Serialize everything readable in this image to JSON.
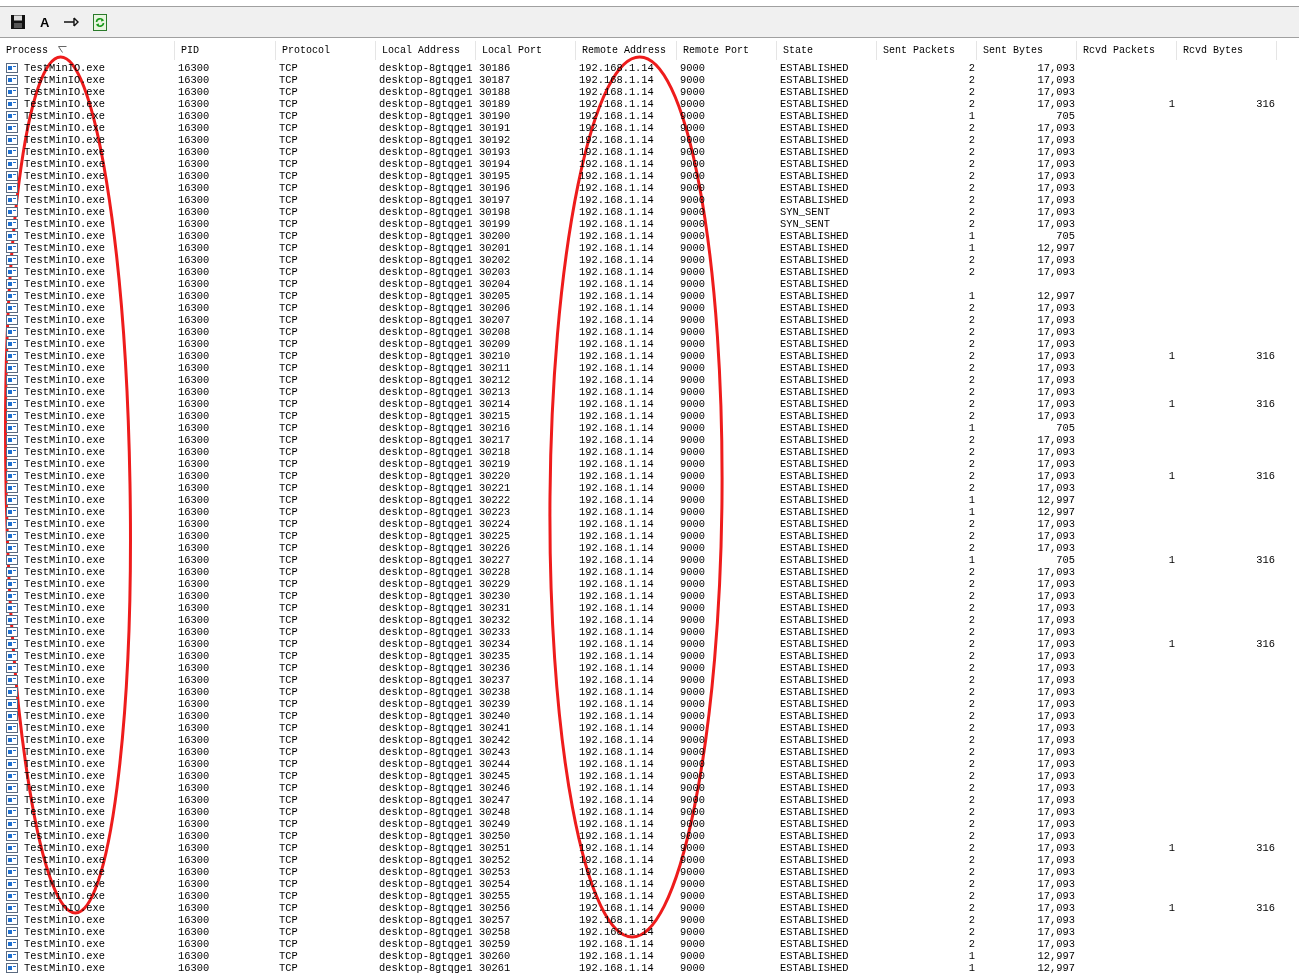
{
  "toolbar": [
    {
      "kind": "save"
    },
    {
      "kind": "text",
      "label": "A"
    },
    {
      "kind": "pin"
    },
    {
      "kind": "refresh"
    }
  ],
  "table": {
    "columns": [
      {
        "label": "Process",
        "sorted": true
      },
      {
        "label": "PID",
        "sorted": false
      },
      {
        "label": "Protocol",
        "sorted": false
      },
      {
        "label": "Local Address",
        "sorted": false
      },
      {
        "label": "Local Port",
        "sorted": false
      },
      {
        "label": "Remote Address",
        "sorted": false
      },
      {
        "label": "Remote Port",
        "sorted": false
      },
      {
        "label": "State",
        "sorted": false
      },
      {
        "label": "Sent Packets",
        "sorted": false
      },
      {
        "label": "Sent Bytes",
        "sorted": false
      },
      {
        "label": "Rcvd Packets",
        "sorted": false
      },
      {
        "label": "Rcvd Bytes",
        "sorted": false
      }
    ],
    "rows": [
      {
        "process": "TestMinIO.exe",
        "pid": "16300",
        "protocol": "TCP",
        "local_address": "desktop-8gtqge1",
        "local_port": "30186",
        "remote_address": "192.168.1.14",
        "remote_port": "9000",
        "state": "ESTABLISHED",
        "sent_packets": "2",
        "sent_bytes": "17,093"
      },
      {
        "process": "TestMinIO.exe",
        "pid": "16300",
        "protocol": "TCP",
        "local_address": "desktop-8gtqge1",
        "local_port": "30187",
        "remote_address": "192.168.1.14",
        "remote_port": "9000",
        "state": "ESTABLISHED",
        "sent_packets": "2",
        "sent_bytes": "17,093"
      },
      {
        "process": "TestMinIO.exe",
        "pid": "16300",
        "protocol": "TCP",
        "local_address": "desktop-8gtqge1",
        "local_port": "30188",
        "remote_address": "192.168.1.14",
        "remote_port": "9000",
        "state": "ESTABLISHED",
        "sent_packets": "2",
        "sent_bytes": "17,093"
      },
      {
        "process": "TestMinIO.exe",
        "pid": "16300",
        "protocol": "TCP",
        "local_address": "desktop-8gtqge1",
        "local_port": "30189",
        "remote_address": "192.168.1.14",
        "remote_port": "9000",
        "state": "ESTABLISHED",
        "sent_packets": "2",
        "sent_bytes": "17,093",
        "rcvd_packets": "1",
        "rcvd_bytes": "316"
      },
      {
        "process": "TestMinIO.exe",
        "pid": "16300",
        "protocol": "TCP",
        "local_address": "desktop-8gtqge1",
        "local_port": "30190",
        "remote_address": "192.168.1.14",
        "remote_port": "9000",
        "state": "ESTABLISHED",
        "sent_packets": "1",
        "sent_bytes": "705"
      },
      {
        "process": "TestMinIO.exe",
        "pid": "16300",
        "protocol": "TCP",
        "local_address": "desktop-8gtqge1",
        "local_port": "30191",
        "remote_address": "192.168.1.14",
        "remote_port": "9000",
        "state": "ESTABLISHED",
        "sent_packets": "2",
        "sent_bytes": "17,093"
      },
      {
        "process": "TestMinIO.exe",
        "pid": "16300",
        "protocol": "TCP",
        "local_address": "desktop-8gtqge1",
        "local_port": "30192",
        "remote_address": "192.168.1.14",
        "remote_port": "9000",
        "state": "ESTABLISHED",
        "sent_packets": "2",
        "sent_bytes": "17,093"
      },
      {
        "process": "TestMinIO.exe",
        "pid": "16300",
        "protocol": "TCP",
        "local_address": "desktop-8gtqge1",
        "local_port": "30193",
        "remote_address": "192.168.1.14",
        "remote_port": "9000",
        "state": "ESTABLISHED",
        "sent_packets": "2",
        "sent_bytes": "17,093"
      },
      {
        "process": "TestMinIO.exe",
        "pid": "16300",
        "protocol": "TCP",
        "local_address": "desktop-8gtqge1",
        "local_port": "30194",
        "remote_address": "192.168.1.14",
        "remote_port": "9000",
        "state": "ESTABLISHED",
        "sent_packets": "2",
        "sent_bytes": "17,093"
      },
      {
        "process": "TestMinIO.exe",
        "pid": "16300",
        "protocol": "TCP",
        "local_address": "desktop-8gtqge1",
        "local_port": "30195",
        "remote_address": "192.168.1.14",
        "remote_port": "9000",
        "state": "ESTABLISHED",
        "sent_packets": "2",
        "sent_bytes": "17,093"
      },
      {
        "process": "TestMinIO.exe",
        "pid": "16300",
        "protocol": "TCP",
        "local_address": "desktop-8gtqge1",
        "local_port": "30196",
        "remote_address": "192.168.1.14",
        "remote_port": "9000",
        "state": "ESTABLISHED",
        "sent_packets": "2",
        "sent_bytes": "17,093"
      },
      {
        "process": "TestMinIO.exe",
        "pid": "16300",
        "protocol": "TCP",
        "local_address": "desktop-8gtqge1",
        "local_port": "30197",
        "remote_address": "192.168.1.14",
        "remote_port": "9000",
        "state": "ESTABLISHED",
        "sent_packets": "2",
        "sent_bytes": "17,093"
      },
      {
        "process": "TestMinIO.exe",
        "pid": "16300",
        "protocol": "TCP",
        "local_address": "desktop-8gtqge1",
        "local_port": "30198",
        "remote_address": "192.168.1.14",
        "remote_port": "9000",
        "state": "SYN_SENT",
        "sent_packets": "2",
        "sent_bytes": "17,093"
      },
      {
        "process": "TestMinIO.exe",
        "pid": "16300",
        "protocol": "TCP",
        "local_address": "desktop-8gtqge1",
        "local_port": "30199",
        "remote_address": "192.168.1.14",
        "remote_port": "9000",
        "state": "SYN_SENT",
        "sent_packets": "2",
        "sent_bytes": "17,093"
      },
      {
        "process": "TestMinIO.exe",
        "pid": "16300",
        "protocol": "TCP",
        "local_address": "desktop-8gtqge1",
        "local_port": "30200",
        "remote_address": "192.168.1.14",
        "remote_port": "9000",
        "state": "ESTABLISHED",
        "sent_packets": "1",
        "sent_bytes": "705"
      },
      {
        "process": "TestMinIO.exe",
        "pid": "16300",
        "protocol": "TCP",
        "local_address": "desktop-8gtqge1",
        "local_port": "30201",
        "remote_address": "192.168.1.14",
        "remote_port": "9000",
        "state": "ESTABLISHED",
        "sent_packets": "1",
        "sent_bytes": "12,997"
      },
      {
        "process": "TestMinIO.exe",
        "pid": "16300",
        "protocol": "TCP",
        "local_address": "desktop-8gtqge1",
        "local_port": "30202",
        "remote_address": "192.168.1.14",
        "remote_port": "9000",
        "state": "ESTABLISHED",
        "sent_packets": "2",
        "sent_bytes": "17,093"
      },
      {
        "process": "TestMinIO.exe",
        "pid": "16300",
        "protocol": "TCP",
        "local_address": "desktop-8gtqge1",
        "local_port": "30203",
        "remote_address": "192.168.1.14",
        "remote_port": "9000",
        "state": "ESTABLISHED",
        "sent_packets": "2",
        "sent_bytes": "17,093"
      },
      {
        "process": "TestMinIO.exe",
        "pid": "16300",
        "protocol": "TCP",
        "local_address": "desktop-8gtqge1",
        "local_port": "30204",
        "remote_address": "192.168.1.14",
        "remote_port": "9000",
        "state": "ESTABLISHED"
      },
      {
        "process": "TestMinIO.exe",
        "pid": "16300",
        "protocol": "TCP",
        "local_address": "desktop-8gtqge1",
        "local_port": "30205",
        "remote_address": "192.168.1.14",
        "remote_port": "9000",
        "state": "ESTABLISHED",
        "sent_packets": "1",
        "sent_bytes": "12,997"
      },
      {
        "process": "TestMinIO.exe",
        "pid": "16300",
        "protocol": "TCP",
        "local_address": "desktop-8gtqge1",
        "local_port": "30206",
        "remote_address": "192.168.1.14",
        "remote_port": "9000",
        "state": "ESTABLISHED",
        "sent_packets": "2",
        "sent_bytes": "17,093"
      },
      {
        "process": "TestMinIO.exe",
        "pid": "16300",
        "protocol": "TCP",
        "local_address": "desktop-8gtqge1",
        "local_port": "30207",
        "remote_address": "192.168.1.14",
        "remote_port": "9000",
        "state": "ESTABLISHED",
        "sent_packets": "2",
        "sent_bytes": "17,093"
      },
      {
        "process": "TestMinIO.exe",
        "pid": "16300",
        "protocol": "TCP",
        "local_address": "desktop-8gtqge1",
        "local_port": "30208",
        "remote_address": "192.168.1.14",
        "remote_port": "9000",
        "state": "ESTABLISHED",
        "sent_packets": "2",
        "sent_bytes": "17,093"
      },
      {
        "process": "TestMinIO.exe",
        "pid": "16300",
        "protocol": "TCP",
        "local_address": "desktop-8gtqge1",
        "local_port": "30209",
        "remote_address": "192.168.1.14",
        "remote_port": "9000",
        "state": "ESTABLISHED",
        "sent_packets": "2",
        "sent_bytes": "17,093"
      },
      {
        "process": "TestMinIO.exe",
        "pid": "16300",
        "protocol": "TCP",
        "local_address": "desktop-8gtqge1",
        "local_port": "30210",
        "remote_address": "192.168.1.14",
        "remote_port": "9000",
        "state": "ESTABLISHED",
        "sent_packets": "2",
        "sent_bytes": "17,093",
        "rcvd_packets": "1",
        "rcvd_bytes": "316"
      },
      {
        "process": "TestMinIO.exe",
        "pid": "16300",
        "protocol": "TCP",
        "local_address": "desktop-8gtqge1",
        "local_port": "30211",
        "remote_address": "192.168.1.14",
        "remote_port": "9000",
        "state": "ESTABLISHED",
        "sent_packets": "2",
        "sent_bytes": "17,093"
      },
      {
        "process": "TestMinIO.exe",
        "pid": "16300",
        "protocol": "TCP",
        "local_address": "desktop-8gtqge1",
        "local_port": "30212",
        "remote_address": "192.168.1.14",
        "remote_port": "9000",
        "state": "ESTABLISHED",
        "sent_packets": "2",
        "sent_bytes": "17,093"
      },
      {
        "process": "TestMinIO.exe",
        "pid": "16300",
        "protocol": "TCP",
        "local_address": "desktop-8gtqge1",
        "local_port": "30213",
        "remote_address": "192.168.1.14",
        "remote_port": "9000",
        "state": "ESTABLISHED",
        "sent_packets": "2",
        "sent_bytes": "17,093"
      },
      {
        "process": "TestMinIO.exe",
        "pid": "16300",
        "protocol": "TCP",
        "local_address": "desktop-8gtqge1",
        "local_port": "30214",
        "remote_address": "192.168.1.14",
        "remote_port": "9000",
        "state": "ESTABLISHED",
        "sent_packets": "2",
        "sent_bytes": "17,093",
        "rcvd_packets": "1",
        "rcvd_bytes": "316"
      },
      {
        "process": "TestMinIO.exe",
        "pid": "16300",
        "protocol": "TCP",
        "local_address": "desktop-8gtqge1",
        "local_port": "30215",
        "remote_address": "192.168.1.14",
        "remote_port": "9000",
        "state": "ESTABLISHED",
        "sent_packets": "2",
        "sent_bytes": "17,093"
      },
      {
        "process": "TestMinIO.exe",
        "pid": "16300",
        "protocol": "TCP",
        "local_address": "desktop-8gtqge1",
        "local_port": "30216",
        "remote_address": "192.168.1.14",
        "remote_port": "9000",
        "state": "ESTABLISHED",
        "sent_packets": "1",
        "sent_bytes": "705"
      },
      {
        "process": "TestMinIO.exe",
        "pid": "16300",
        "protocol": "TCP",
        "local_address": "desktop-8gtqge1",
        "local_port": "30217",
        "remote_address": "192.168.1.14",
        "remote_port": "9000",
        "state": "ESTABLISHED",
        "sent_packets": "2",
        "sent_bytes": "17,093"
      },
      {
        "process": "TestMinIO.exe",
        "pid": "16300",
        "protocol": "TCP",
        "local_address": "desktop-8gtqge1",
        "local_port": "30218",
        "remote_address": "192.168.1.14",
        "remote_port": "9000",
        "state": "ESTABLISHED",
        "sent_packets": "2",
        "sent_bytes": "17,093"
      },
      {
        "process": "TestMinIO.exe",
        "pid": "16300",
        "protocol": "TCP",
        "local_address": "desktop-8gtqge1",
        "local_port": "30219",
        "remote_address": "192.168.1.14",
        "remote_port": "9000",
        "state": "ESTABLISHED",
        "sent_packets": "2",
        "sent_bytes": "17,093"
      },
      {
        "process": "TestMinIO.exe",
        "pid": "16300",
        "protocol": "TCP",
        "local_address": "desktop-8gtqge1",
        "local_port": "30220",
        "remote_address": "192.168.1.14",
        "remote_port": "9000",
        "state": "ESTABLISHED",
        "sent_packets": "2",
        "sent_bytes": "17,093",
        "rcvd_packets": "1",
        "rcvd_bytes": "316"
      },
      {
        "process": "TestMinIO.exe",
        "pid": "16300",
        "protocol": "TCP",
        "local_address": "desktop-8gtqge1",
        "local_port": "30221",
        "remote_address": "192.168.1.14",
        "remote_port": "9000",
        "state": "ESTABLISHED",
        "sent_packets": "2",
        "sent_bytes": "17,093"
      },
      {
        "process": "TestMinIO.exe",
        "pid": "16300",
        "protocol": "TCP",
        "local_address": "desktop-8gtqge1",
        "local_port": "30222",
        "remote_address": "192.168.1.14",
        "remote_port": "9000",
        "state": "ESTABLISHED",
        "sent_packets": "1",
        "sent_bytes": "12,997"
      },
      {
        "process": "TestMinIO.exe",
        "pid": "16300",
        "protocol": "TCP",
        "local_address": "desktop-8gtqge1",
        "local_port": "30223",
        "remote_address": "192.168.1.14",
        "remote_port": "9000",
        "state": "ESTABLISHED",
        "sent_packets": "1",
        "sent_bytes": "12,997"
      },
      {
        "process": "TestMinIO.exe",
        "pid": "16300",
        "protocol": "TCP",
        "local_address": "desktop-8gtqge1",
        "local_port": "30224",
        "remote_address": "192.168.1.14",
        "remote_port": "9000",
        "state": "ESTABLISHED",
        "sent_packets": "2",
        "sent_bytes": "17,093"
      },
      {
        "process": "TestMinIO.exe",
        "pid": "16300",
        "protocol": "TCP",
        "local_address": "desktop-8gtqge1",
        "local_port": "30225",
        "remote_address": "192.168.1.14",
        "remote_port": "9000",
        "state": "ESTABLISHED",
        "sent_packets": "2",
        "sent_bytes": "17,093"
      },
      {
        "process": "TestMinIO.exe",
        "pid": "16300",
        "protocol": "TCP",
        "local_address": "desktop-8gtqge1",
        "local_port": "30226",
        "remote_address": "192.168.1.14",
        "remote_port": "9000",
        "state": "ESTABLISHED",
        "sent_packets": "2",
        "sent_bytes": "17,093"
      },
      {
        "process": "TestMinIO.exe",
        "pid": "16300",
        "protocol": "TCP",
        "local_address": "desktop-8gtqge1",
        "local_port": "30227",
        "remote_address": "192.168.1.14",
        "remote_port": "9000",
        "state": "ESTABLISHED",
        "sent_packets": "1",
        "sent_bytes": "705",
        "rcvd_packets": "1",
        "rcvd_bytes": "316"
      },
      {
        "process": "TestMinIO.exe",
        "pid": "16300",
        "protocol": "TCP",
        "local_address": "desktop-8gtqge1",
        "local_port": "30228",
        "remote_address": "192.168.1.14",
        "remote_port": "9000",
        "state": "ESTABLISHED",
        "sent_packets": "2",
        "sent_bytes": "17,093"
      },
      {
        "process": "TestMinIO.exe",
        "pid": "16300",
        "protocol": "TCP",
        "local_address": "desktop-8gtqge1",
        "local_port": "30229",
        "remote_address": "192.168.1.14",
        "remote_port": "9000",
        "state": "ESTABLISHED",
        "sent_packets": "2",
        "sent_bytes": "17,093"
      },
      {
        "process": "TestMinIO.exe",
        "pid": "16300",
        "protocol": "TCP",
        "local_address": "desktop-8gtqge1",
        "local_port": "30230",
        "remote_address": "192.168.1.14",
        "remote_port": "9000",
        "state": "ESTABLISHED",
        "sent_packets": "2",
        "sent_bytes": "17,093"
      },
      {
        "process": "TestMinIO.exe",
        "pid": "16300",
        "protocol": "TCP",
        "local_address": "desktop-8gtqge1",
        "local_port": "30231",
        "remote_address": "192.168.1.14",
        "remote_port": "9000",
        "state": "ESTABLISHED",
        "sent_packets": "2",
        "sent_bytes": "17,093"
      },
      {
        "process": "TestMinIO.exe",
        "pid": "16300",
        "protocol": "TCP",
        "local_address": "desktop-8gtqge1",
        "local_port": "30232",
        "remote_address": "192.168.1.14",
        "remote_port": "9000",
        "state": "ESTABLISHED",
        "sent_packets": "2",
        "sent_bytes": "17,093"
      },
      {
        "process": "TestMinIO.exe",
        "pid": "16300",
        "protocol": "TCP",
        "local_address": "desktop-8gtqge1",
        "local_port": "30233",
        "remote_address": "192.168.1.14",
        "remote_port": "9000",
        "state": "ESTABLISHED",
        "sent_packets": "2",
        "sent_bytes": "17,093"
      },
      {
        "process": "TestMinIO.exe",
        "pid": "16300",
        "protocol": "TCP",
        "local_address": "desktop-8gtqge1",
        "local_port": "30234",
        "remote_address": "192.168.1.14",
        "remote_port": "9000",
        "state": "ESTABLISHED",
        "sent_packets": "2",
        "sent_bytes": "17,093",
        "rcvd_packets": "1",
        "rcvd_bytes": "316"
      },
      {
        "process": "TestMinIO.exe",
        "pid": "16300",
        "protocol": "TCP",
        "local_address": "desktop-8gtqge1",
        "local_port": "30235",
        "remote_address": "192.168.1.14",
        "remote_port": "9000",
        "state": "ESTABLISHED",
        "sent_packets": "2",
        "sent_bytes": "17,093"
      },
      {
        "process": "TestMinIO.exe",
        "pid": "16300",
        "protocol": "TCP",
        "local_address": "desktop-8gtqge1",
        "local_port": "30236",
        "remote_address": "192.168.1.14",
        "remote_port": "9000",
        "state": "ESTABLISHED",
        "sent_packets": "2",
        "sent_bytes": "17,093"
      },
      {
        "process": "TestMinIO.exe",
        "pid": "16300",
        "protocol": "TCP",
        "local_address": "desktop-8gtqge1",
        "local_port": "30237",
        "remote_address": "192.168.1.14",
        "remote_port": "9000",
        "state": "ESTABLISHED",
        "sent_packets": "2",
        "sent_bytes": "17,093"
      },
      {
        "process": "TestMinIO.exe",
        "pid": "16300",
        "protocol": "TCP",
        "local_address": "desktop-8gtqge1",
        "local_port": "30238",
        "remote_address": "192.168.1.14",
        "remote_port": "9000",
        "state": "ESTABLISHED",
        "sent_packets": "2",
        "sent_bytes": "17,093"
      },
      {
        "process": "TestMinIO.exe",
        "pid": "16300",
        "protocol": "TCP",
        "local_address": "desktop-8gtqge1",
        "local_port": "30239",
        "remote_address": "192.168.1.14",
        "remote_port": "9000",
        "state": "ESTABLISHED",
        "sent_packets": "2",
        "sent_bytes": "17,093"
      },
      {
        "process": "TestMinIO.exe",
        "pid": "16300",
        "protocol": "TCP",
        "local_address": "desktop-8gtqge1",
        "local_port": "30240",
        "remote_address": "192.168.1.14",
        "remote_port": "9000",
        "state": "ESTABLISHED",
        "sent_packets": "2",
        "sent_bytes": "17,093"
      },
      {
        "process": "TestMinIO.exe",
        "pid": "16300",
        "protocol": "TCP",
        "local_address": "desktop-8gtqge1",
        "local_port": "30241",
        "remote_address": "192.168.1.14",
        "remote_port": "9000",
        "state": "ESTABLISHED",
        "sent_packets": "2",
        "sent_bytes": "17,093"
      },
      {
        "process": "TestMinIO.exe",
        "pid": "16300",
        "protocol": "TCP",
        "local_address": "desktop-8gtqge1",
        "local_port": "30242",
        "remote_address": "192.168.1.14",
        "remote_port": "9000",
        "state": "ESTABLISHED",
        "sent_packets": "2",
        "sent_bytes": "17,093"
      },
      {
        "process": "TestMinIO.exe",
        "pid": "16300",
        "protocol": "TCP",
        "local_address": "desktop-8gtqge1",
        "local_port": "30243",
        "remote_address": "192.168.1.14",
        "remote_port": "9000",
        "state": "ESTABLISHED",
        "sent_packets": "2",
        "sent_bytes": "17,093"
      },
      {
        "process": "TestMinIO.exe",
        "pid": "16300",
        "protocol": "TCP",
        "local_address": "desktop-8gtqge1",
        "local_port": "30244",
        "remote_address": "192.168.1.14",
        "remote_port": "9000",
        "state": "ESTABLISHED",
        "sent_packets": "2",
        "sent_bytes": "17,093"
      },
      {
        "process": "TestMinIO.exe",
        "pid": "16300",
        "protocol": "TCP",
        "local_address": "desktop-8gtqge1",
        "local_port": "30245",
        "remote_address": "192.168.1.14",
        "remote_port": "9000",
        "state": "ESTABLISHED",
        "sent_packets": "2",
        "sent_bytes": "17,093"
      },
      {
        "process": "TestMinIO.exe",
        "pid": "16300",
        "protocol": "TCP",
        "local_address": "desktop-8gtqge1",
        "local_port": "30246",
        "remote_address": "192.168.1.14",
        "remote_port": "9000",
        "state": "ESTABLISHED",
        "sent_packets": "2",
        "sent_bytes": "17,093"
      },
      {
        "process": "TestMinIO.exe",
        "pid": "16300",
        "protocol": "TCP",
        "local_address": "desktop-8gtqge1",
        "local_port": "30247",
        "remote_address": "192.168.1.14",
        "remote_port": "9000",
        "state": "ESTABLISHED",
        "sent_packets": "2",
        "sent_bytes": "17,093"
      },
      {
        "process": "TestMinIO.exe",
        "pid": "16300",
        "protocol": "TCP",
        "local_address": "desktop-8gtqge1",
        "local_port": "30248",
        "remote_address": "192.168.1.14",
        "remote_port": "9000",
        "state": "ESTABLISHED",
        "sent_packets": "2",
        "sent_bytes": "17,093"
      },
      {
        "process": "TestMinIO.exe",
        "pid": "16300",
        "protocol": "TCP",
        "local_address": "desktop-8gtqge1",
        "local_port": "30249",
        "remote_address": "192.168.1.14",
        "remote_port": "9000",
        "state": "ESTABLISHED",
        "sent_packets": "2",
        "sent_bytes": "17,093"
      },
      {
        "process": "TestMinIO.exe",
        "pid": "16300",
        "protocol": "TCP",
        "local_address": "desktop-8gtqge1",
        "local_port": "30250",
        "remote_address": "192.168.1.14",
        "remote_port": "9000",
        "state": "ESTABLISHED",
        "sent_packets": "2",
        "sent_bytes": "17,093"
      },
      {
        "process": "TestMinIO.exe",
        "pid": "16300",
        "protocol": "TCP",
        "local_address": "desktop-8gtqge1",
        "local_port": "30251",
        "remote_address": "192.168.1.14",
        "remote_port": "9000",
        "state": "ESTABLISHED",
        "sent_packets": "2",
        "sent_bytes": "17,093",
        "rcvd_packets": "1",
        "rcvd_bytes": "316"
      },
      {
        "process": "TestMinIO.exe",
        "pid": "16300",
        "protocol": "TCP",
        "local_address": "desktop-8gtqge1",
        "local_port": "30252",
        "remote_address": "192.168.1.14",
        "remote_port": "9000",
        "state": "ESTABLISHED",
        "sent_packets": "2",
        "sent_bytes": "17,093"
      },
      {
        "process": "TestMinIO.exe",
        "pid": "16300",
        "protocol": "TCP",
        "local_address": "desktop-8gtqge1",
        "local_port": "30253",
        "remote_address": "192.168.1.14",
        "remote_port": "9000",
        "state": "ESTABLISHED",
        "sent_packets": "2",
        "sent_bytes": "17,093"
      },
      {
        "process": "TestMinIO.exe",
        "pid": "16300",
        "protocol": "TCP",
        "local_address": "desktop-8gtqge1",
        "local_port": "30254",
        "remote_address": "192.168.1.14",
        "remote_port": "9000",
        "state": "ESTABLISHED",
        "sent_packets": "2",
        "sent_bytes": "17,093"
      },
      {
        "process": "TestMinIO.exe",
        "pid": "16300",
        "protocol": "TCP",
        "local_address": "desktop-8gtqge1",
        "local_port": "30255",
        "remote_address": "192.168.1.14",
        "remote_port": "9000",
        "state": "ESTABLISHED",
        "sent_packets": "2",
        "sent_bytes": "17,093"
      },
      {
        "process": "TestMinIO.exe",
        "pid": "16300",
        "protocol": "TCP",
        "local_address": "desktop-8gtqge1",
        "local_port": "30256",
        "remote_address": "192.168.1.14",
        "remote_port": "9000",
        "state": "ESTABLISHED",
        "sent_packets": "2",
        "sent_bytes": "17,093",
        "rcvd_packets": "1",
        "rcvd_bytes": "316"
      },
      {
        "process": "TestMinIO.exe",
        "pid": "16300",
        "protocol": "TCP",
        "local_address": "desktop-8gtqge1",
        "local_port": "30257",
        "remote_address": "192.168.1.14",
        "remote_port": "9000",
        "state": "ESTABLISHED",
        "sent_packets": "2",
        "sent_bytes": "17,093"
      },
      {
        "process": "TestMinIO.exe",
        "pid": "16300",
        "protocol": "TCP",
        "local_address": "desktop-8gtqge1",
        "local_port": "30258",
        "remote_address": "192.168.1.14",
        "remote_port": "9000",
        "state": "ESTABLISHED",
        "sent_packets": "2",
        "sent_bytes": "17,093"
      },
      {
        "process": "TestMinIO.exe",
        "pid": "16300",
        "protocol": "TCP",
        "local_address": "desktop-8gtqge1",
        "local_port": "30259",
        "remote_address": "192.168.1.14",
        "remote_port": "9000",
        "state": "ESTABLISHED",
        "sent_packets": "2",
        "sent_bytes": "17,093"
      },
      {
        "process": "TestMinIO.exe",
        "pid": "16300",
        "protocol": "TCP",
        "local_address": "desktop-8gtqge1",
        "local_port": "30260",
        "remote_address": "192.168.1.14",
        "remote_port": "9000",
        "state": "ESTABLISHED",
        "sent_packets": "1",
        "sent_bytes": "12,997"
      },
      {
        "process": "TestMinIO.exe",
        "pid": "16300",
        "protocol": "TCP",
        "local_address": "desktop-8gtqge1",
        "local_port": "30261",
        "remote_address": "192.168.1.14",
        "remote_port": "9000",
        "state": "ESTABLISHED",
        "sent_packets": "1",
        "sent_bytes": "12,997"
      }
    ]
  }
}
